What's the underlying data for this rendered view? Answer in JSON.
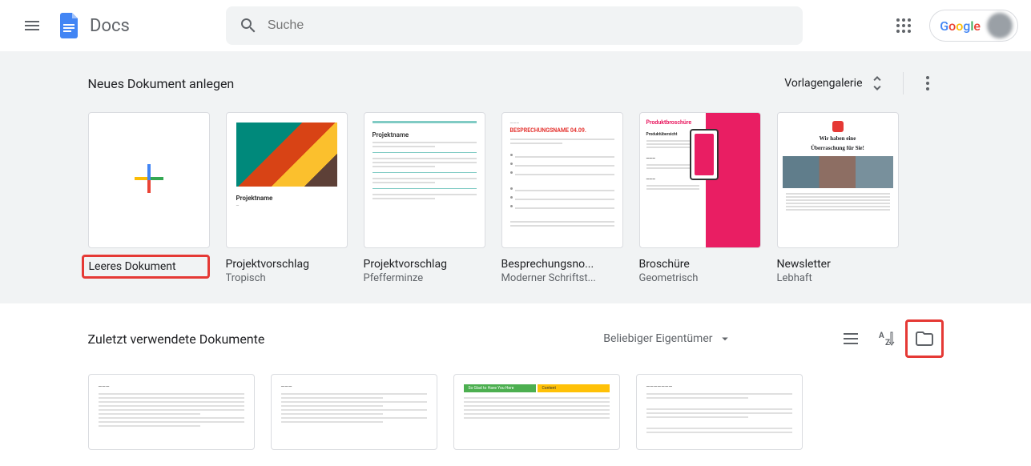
{
  "header": {
    "app_name": "Docs",
    "search_placeholder": "Suche"
  },
  "templates": {
    "section_title": "Neues Dokument anlegen",
    "gallery_label": "Vorlagengalerie",
    "items": [
      {
        "title": "Leeres Dokument",
        "sub": ""
      },
      {
        "title": "Projektvorschlag",
        "sub": "Tropisch"
      },
      {
        "title": "Projektvorschlag",
        "sub": "Pfefferminze"
      },
      {
        "title": "Besprechungsno...",
        "sub": "Moderner Schriftst..."
      },
      {
        "title": "Broschüre",
        "sub": "Geometrisch"
      },
      {
        "title": "Newsletter",
        "sub": "Lebhaft"
      }
    ]
  },
  "thumb_text": {
    "projektname": "Projektname",
    "besprechung": "BESPRECHUNGSNAME 04.09.",
    "brochure_h": "Produktbroschüre",
    "brochure_sh": "Produktübersicht",
    "news_h1": "Wir haben eine",
    "news_h2": "Überraschung für Sie!"
  },
  "recent": {
    "section_title": "Zuletzt verwendete Dokumente",
    "owner_label": "Beliebiger Eigentümer"
  }
}
